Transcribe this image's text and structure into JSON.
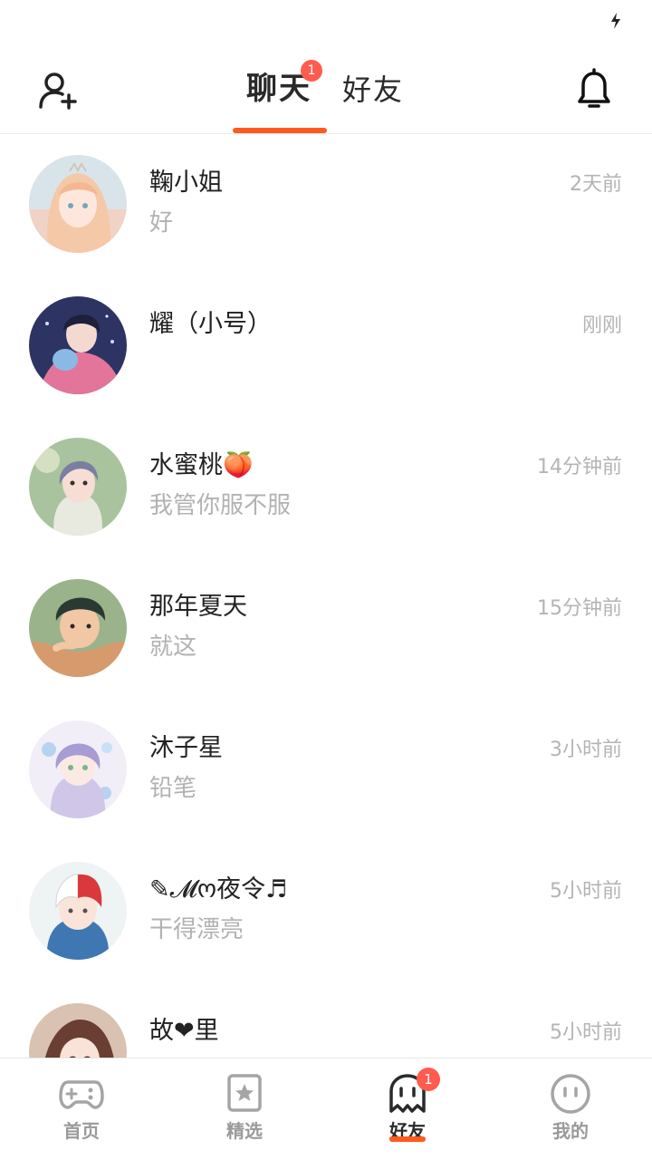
{
  "header": {
    "tabs": [
      {
        "label": "聊天",
        "badge": "1",
        "active": true
      },
      {
        "label": "好友",
        "active": false
      }
    ]
  },
  "chats": [
    {
      "name": "鞠小姐",
      "preview": "好",
      "time": "2天前",
      "avatar_color": "#f3c9b8"
    },
    {
      "name": "耀（小号）",
      "preview": "",
      "time": "刚刚",
      "avatar_color": "#3b3f6b"
    },
    {
      "name": "水蜜桃🍑",
      "preview": "我管你服不服",
      "time": "14分钟前",
      "avatar_color": "#9bb59a"
    },
    {
      "name": "那年夏天",
      "preview": "就这",
      "time": "15分钟前",
      "avatar_color": "#e7b48f"
    },
    {
      "name": "沐子星",
      "preview": "铅笔",
      "time": "3小时前",
      "avatar_color": "#d9d4ee"
    },
    {
      "name": "✎𝓜ო夜令♬",
      "preview": "干得漂亮",
      "time": "5小时前",
      "avatar_color": "#e8e2dc"
    },
    {
      "name": "故❤里",
      "preview": "",
      "time": "5小时前",
      "avatar_color": "#9a6b55"
    }
  ],
  "tabbar": {
    "items": [
      {
        "label": "首页",
        "icon": "gamepad-icon",
        "active": false
      },
      {
        "label": "精选",
        "icon": "star-bookmark-icon",
        "active": false
      },
      {
        "label": "好友",
        "icon": "ghost-icon",
        "active": true,
        "badge": "1"
      },
      {
        "label": "我的",
        "icon": "face-icon",
        "active": false
      }
    ]
  },
  "colors": {
    "accent": "#ff5a1f",
    "badge": "#ff5b4f",
    "muted_text": "#b4b4b4"
  }
}
